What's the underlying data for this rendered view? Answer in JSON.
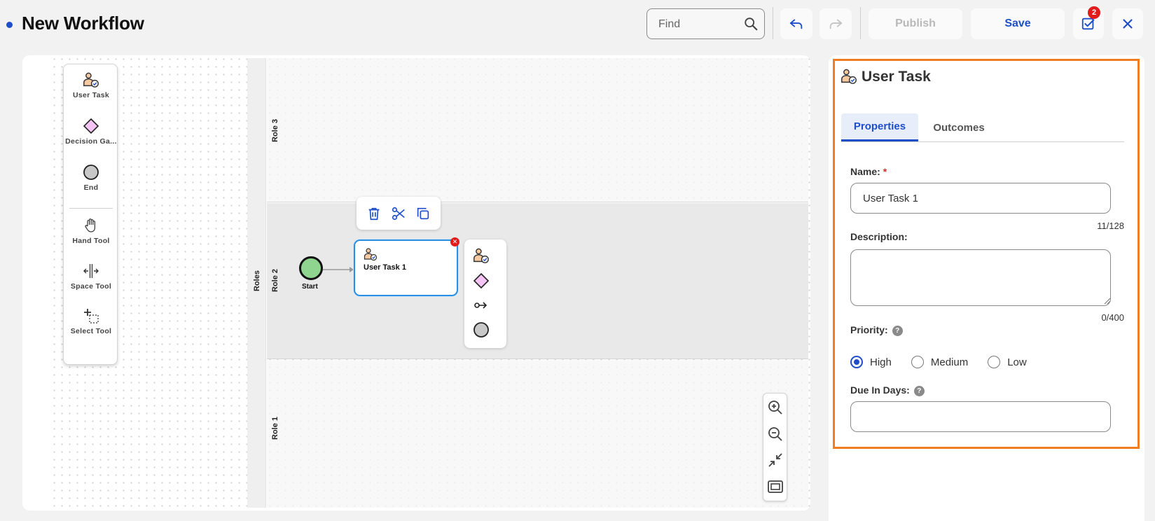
{
  "header": {
    "title": "New Workflow",
    "find_placeholder": "Find",
    "publish_label": "Publish",
    "save_label": "Save",
    "tasks_badge_count": "2"
  },
  "palette": {
    "items": [
      {
        "label": "User Task",
        "icon": "user-task-icon"
      },
      {
        "label": "Decision Ga...",
        "icon": "decision-gateway-icon"
      },
      {
        "label": "End",
        "icon": "end-event-icon"
      },
      {
        "label": "Hand Tool",
        "icon": "hand-tool-icon"
      },
      {
        "label": "Space Tool",
        "icon": "space-tool-icon"
      },
      {
        "label": "Select Tool",
        "icon": "select-tool-icon"
      }
    ]
  },
  "diagram": {
    "pool_label": "Roles",
    "lanes": [
      "Role 3",
      "Role 2",
      "Role 1"
    ],
    "start_label": "Start",
    "task_label": "User Task 1"
  },
  "panel": {
    "title": "User Task",
    "tabs": [
      {
        "label": "Properties",
        "active": true
      },
      {
        "label": "Outcomes",
        "active": false
      }
    ],
    "name_label": "Name:",
    "required_mark": "*",
    "name_value": "User Task 1",
    "name_counter": "11/128",
    "description_label": "Description:",
    "description_value": "",
    "description_counter": "0/400",
    "priority_label": "Priority:",
    "priority_options": [
      "High",
      "Medium",
      "Low"
    ],
    "priority_selected": "High",
    "due_label": "Due In Days:",
    "due_value": ""
  },
  "colors": {
    "accent": "#1e4ec8",
    "selection_border": "#f07d22",
    "start_event": "#8fd48f",
    "gateway": "#f4c4f4",
    "badge": "#e21c1c"
  }
}
